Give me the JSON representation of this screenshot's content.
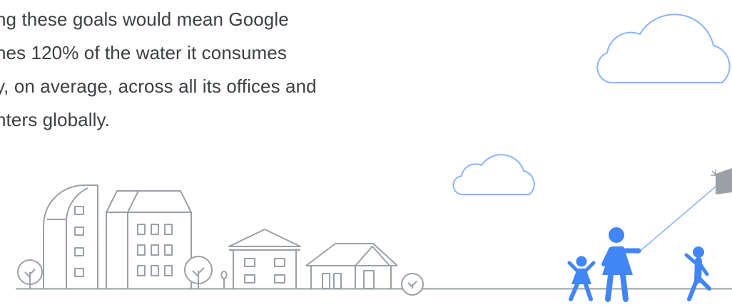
{
  "paragraph": {
    "lines": [
      "ng these goals would mean Google",
      "hes 120% of the water it consumes",
      "y, on average, across all its offices and",
      "nters globally."
    ]
  },
  "palette": {
    "text": "#3c4043",
    "outline": "#9aa0a6",
    "cloud": "#8ab4f8",
    "people": "#4285f4",
    "kite": "#9aa0a6"
  },
  "icons": [
    "cloud-icon",
    "building-icon",
    "house-icon",
    "tree-icon",
    "person-icon",
    "kite-icon"
  ]
}
